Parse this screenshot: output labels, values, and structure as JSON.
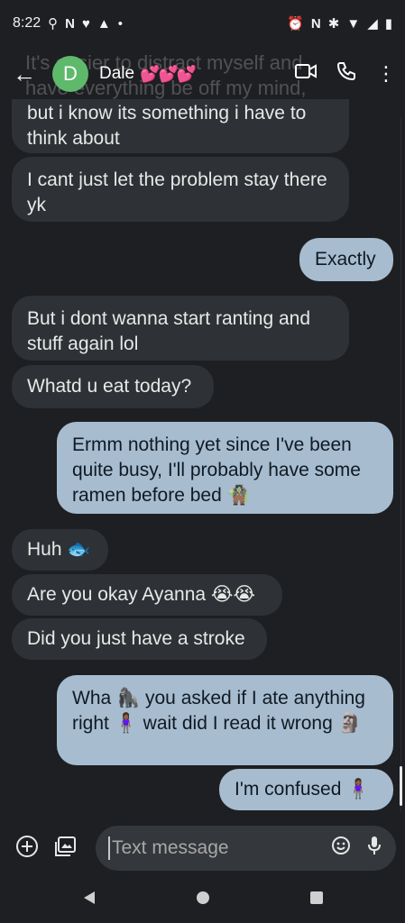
{
  "status": {
    "time": "8:22",
    "left_icons": [
      "alarm-icon",
      "notification-n-icon",
      "heart-icon",
      "warning-icon",
      "dot-icon"
    ],
    "right_icons": [
      "alarm-clock-icon",
      "nfc-icon",
      "bluetooth-icon",
      "wifi-icon",
      "signal-icon",
      "battery-icon"
    ]
  },
  "header": {
    "avatar_letter": "D",
    "contact_name": "Dale",
    "contact_emoji": "💕💕💕"
  },
  "ghost_text": "It's easier to distract myself and have everything be off my mind,",
  "messages": [
    {
      "dir": "in",
      "text": "but i know its something i have to think about"
    },
    {
      "dir": "in",
      "text": "I cant just let the problem stay there yk"
    },
    {
      "dir": "out",
      "text": "Exactly"
    },
    {
      "dir": "in",
      "text": "But i dont wanna start ranting and stuff again lol"
    },
    {
      "dir": "in",
      "text": "Whatd u eat today?"
    },
    {
      "dir": "out",
      "text": "Ermm nothing yet since I've been quite busy, I'll probably have some ramen before bed 🧌"
    },
    {
      "dir": "in",
      "text": "Huh 🐟"
    },
    {
      "dir": "in",
      "text": "Are you okay Ayanna 😭😭"
    },
    {
      "dir": "in",
      "text": "Did you just have a stroke"
    },
    {
      "dir": "out",
      "text": "Wha 🦍 you asked if I ate anything right 🧍🏾‍♀️ wait did I read it wrong 🗿"
    },
    {
      "dir": "out",
      "text": "I'm confused 🧍🏾‍♀️"
    }
  ],
  "composer": {
    "placeholder": "Text message"
  }
}
